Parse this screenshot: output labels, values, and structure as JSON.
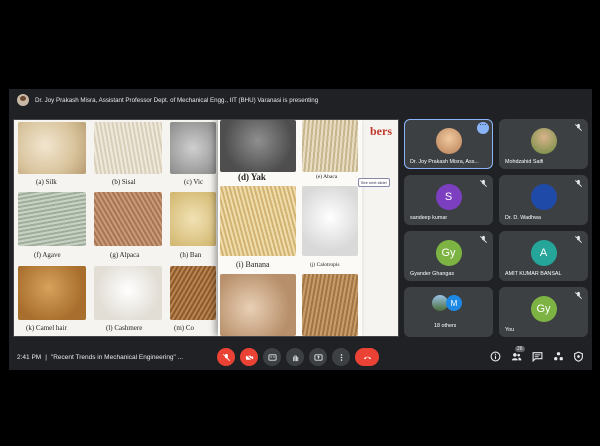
{
  "banner": {
    "text": "Dr. Joy Prakash Misra, Assistant Professor Dept. of Mechanical Engg., IIT (BHU) Varanasi is presenting"
  },
  "slide": {
    "heading": "bers",
    "side_note": "See next slide!",
    "captions": [
      "(a) Silk",
      "(b) Sisal",
      "(c) Vic",
      "(d) Yak",
      "(e) Abaca",
      "(f) Agave",
      "(g) Alpaca",
      "(h) Ban",
      "(i) Banana",
      "(j) Calotropis",
      "(k) Camel hair",
      "(l) Cashmere",
      "(m) Co"
    ]
  },
  "participants": [
    {
      "name": "Dr. Joy Prakash Misra, Ass...",
      "initial": "",
      "color": "#5c6bc0",
      "muted": false,
      "active": true
    },
    {
      "name": "Mohdzahid Saifi",
      "initial": "",
      "color": "#7a5c3e",
      "muted": true,
      "active": false
    },
    {
      "name": "sandeep kumar",
      "initial": "S",
      "color": "#7b3fbf",
      "muted": true,
      "active": false
    },
    {
      "name": "Dr. D. Wadhwa",
      "initial": "",
      "color": "#1f4aa8",
      "muted": true,
      "active": false
    },
    {
      "name": "Gyander Ghangas",
      "initial": "Gy",
      "color": "#7cb342",
      "muted": true,
      "active": false
    },
    {
      "name": "AMIT KUMAR BANSAL",
      "initial": "A",
      "color": "#26a69a",
      "muted": true,
      "active": false
    },
    {
      "name": "18 others",
      "initial": "M",
      "color": "#1e88e5",
      "muted": false,
      "active": false
    },
    {
      "name": "You",
      "initial": "Gy",
      "color": "#7cb342",
      "muted": true,
      "active": false
    }
  ],
  "bottom_bar": {
    "time": "2:41 PM",
    "separator": "|",
    "meeting_title": "\"Recent Trends in Mechanical Engineering\" ...",
    "people_count": "26"
  },
  "colors": {
    "accent": "#8ab4f8",
    "danger": "#ea4335",
    "surface": "#202124",
    "tile": "#3c4043"
  }
}
